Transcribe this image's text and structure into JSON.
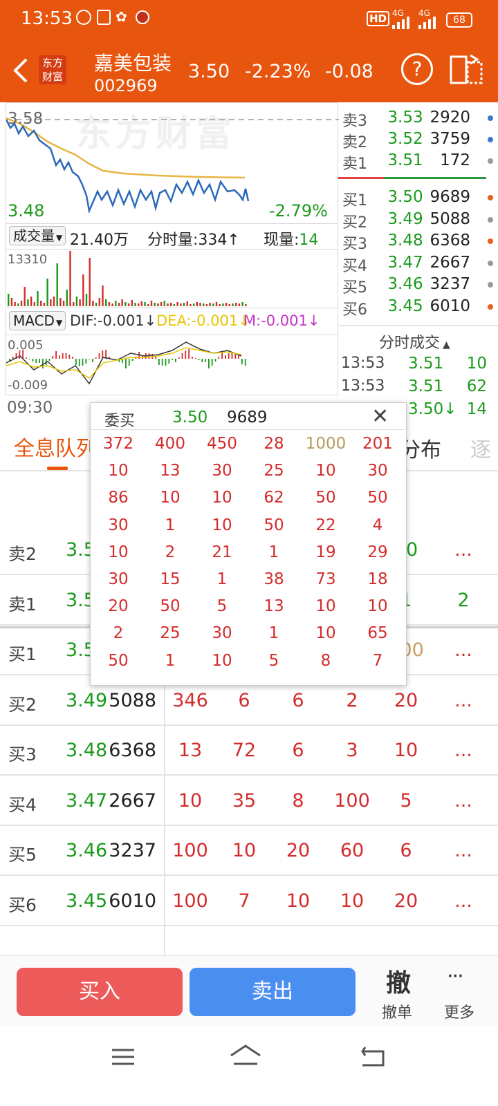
{
  "status_bar": {
    "time": "13:53",
    "hd": "HD",
    "net1": "4G",
    "net2": "4G",
    "battery": "68"
  },
  "header": {
    "brand": "东方财富",
    "stock_name": "嘉美包装",
    "stock_code": "002969",
    "price": "3.50",
    "change_pct": "-2.23%",
    "change": "-0.08",
    "help_glyph": "?"
  },
  "chart": {
    "watermark": "东方财富",
    "high_label": "3.58",
    "low_label": "3.48",
    "change_label": "-2.79%",
    "volume_bar": {
      "selector": "成交量",
      "total": "21.40万",
      "tick_label": "分时量:334",
      "tick_arrow": "↑",
      "now_label": "现量:",
      "now_value": "14"
    },
    "volume_max": "13310",
    "macd": {
      "selector": "MACD",
      "dif": "DIF:-0.001↓",
      "dea": "DEA:-0.001↓",
      "m": "M:-0.001↓",
      "top": "0.005",
      "bottom": "-0.009"
    },
    "time_start": "09:30",
    "colors": {
      "price_line": "#2a6ab8",
      "avg_line": "#e8b443",
      "up": "#d42b2b",
      "down": "#1a9a1a",
      "dea": "#e8c400",
      "m": "#c832c8"
    }
  },
  "order_book": {
    "sell": [
      {
        "label": "卖3",
        "price": "3.53",
        "vol": "2920",
        "dot": "#3a78d0"
      },
      {
        "label": "卖2",
        "price": "3.52",
        "vol": "3759",
        "dot": "#3a78d0"
      },
      {
        "label": "卖1",
        "price": "3.51",
        "vol": "172",
        "dot": "#9a9a9a"
      }
    ],
    "buy": [
      {
        "label": "买1",
        "price": "3.50",
        "vol": "9689",
        "dot": "#e86020"
      },
      {
        "label": "买2",
        "price": "3.49",
        "vol": "5088",
        "dot": "#9a9a9a"
      },
      {
        "label": "买3",
        "price": "3.48",
        "vol": "6368",
        "dot": "#e86020"
      },
      {
        "label": "买4",
        "price": "3.47",
        "vol": "2667",
        "dot": "#9a9a9a"
      },
      {
        "label": "买5",
        "price": "3.46",
        "vol": "3237",
        "dot": "#9a9a9a"
      },
      {
        "label": "买6",
        "price": "3.45",
        "vol": "6010",
        "dot": "#e86020"
      }
    ]
  },
  "trades": {
    "title": "分时成交",
    "rows": [
      {
        "time": "13:53",
        "price": "3.51",
        "vol": "10"
      },
      {
        "time": "13:53",
        "price": "3.51",
        "vol": "62"
      },
      {
        "time": "",
        "price": "3.50↓",
        "vol": "14"
      }
    ]
  },
  "tabs": {
    "active": "全息队列",
    "right": "分布"
  },
  "queue": {
    "rows": [
      {
        "label": "卖2",
        "price": "3.5",
        "vol": "",
        "cells": [
          "",
          "",
          "",
          "",
          "10"
        ],
        "more": "..."
      },
      {
        "label": "卖1",
        "price": "3.5",
        "vol": "",
        "cells": [
          "",
          "",
          "",
          "",
          "1"
        ],
        "more": "2"
      },
      {
        "label": "买1",
        "price": "3.5",
        "vol": "",
        "cells": [
          "",
          "",
          "",
          "",
          "000"
        ],
        "more": "..."
      },
      {
        "label": "买2",
        "price": "3.49",
        "vol": "5088",
        "cells": [
          "346",
          "6",
          "6",
          "2",
          "20"
        ],
        "more": "..."
      },
      {
        "label": "买3",
        "price": "3.48",
        "vol": "6368",
        "cells": [
          "13",
          "72",
          "6",
          "3",
          "10"
        ],
        "more": "..."
      },
      {
        "label": "买4",
        "price": "3.47",
        "vol": "2667",
        "cells": [
          "10",
          "35",
          "8",
          "100",
          "5"
        ],
        "more": "..."
      },
      {
        "label": "买5",
        "price": "3.46",
        "vol": "3237",
        "cells": [
          "100",
          "10",
          "20",
          "60",
          "6"
        ],
        "more": "..."
      },
      {
        "label": "买6",
        "price": "3.45",
        "vol": "6010",
        "cells": [
          "100",
          "7",
          "10",
          "10",
          "20"
        ],
        "more": "..."
      }
    ]
  },
  "popup": {
    "title": "委买",
    "price": "3.50",
    "volume": "9689",
    "close_glyph": "✕",
    "grid": [
      [
        "372",
        "400",
        "450",
        "28",
        "1000",
        "201"
      ],
      [
        "10",
        "13",
        "30",
        "25",
        "10",
        "30"
      ],
      [
        "86",
        "10",
        "10",
        "62",
        "50",
        "50"
      ],
      [
        "30",
        "1",
        "10",
        "50",
        "22",
        "4"
      ],
      [
        "10",
        "2",
        "21",
        "1",
        "19",
        "29"
      ],
      [
        "30",
        "15",
        "1",
        "38",
        "73",
        "18"
      ],
      [
        "20",
        "50",
        "5",
        "13",
        "10",
        "10"
      ],
      [
        "2",
        "25",
        "30",
        "1",
        "10",
        "65"
      ],
      [
        "50",
        "1",
        "10",
        "5",
        "8",
        "7"
      ]
    ]
  },
  "bottom_bar": {
    "buy": "买入",
    "sell": "卖出",
    "cancel_glyph": "撤",
    "cancel_label": "撤单",
    "more_glyph": "···",
    "more_label": "更多"
  }
}
